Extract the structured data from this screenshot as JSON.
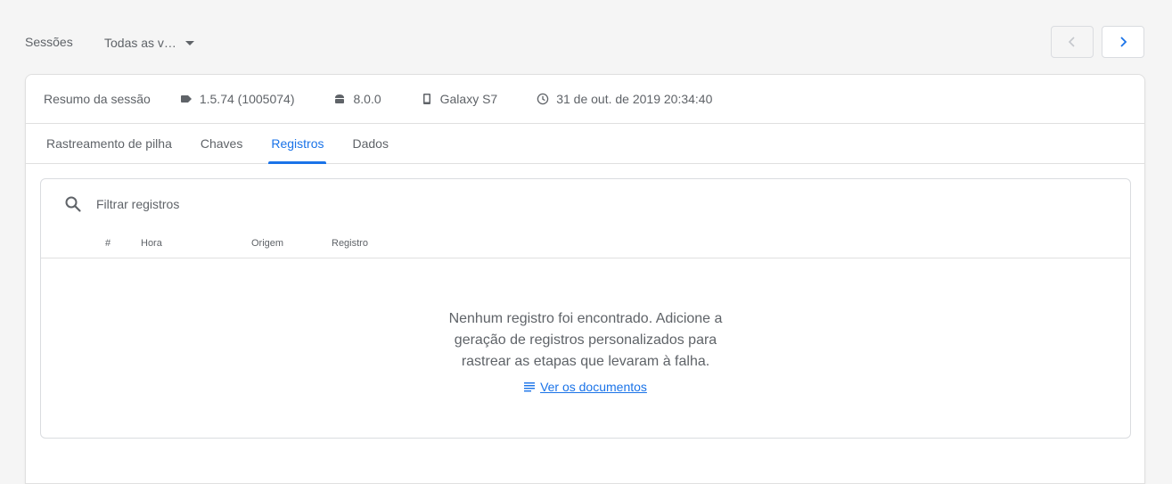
{
  "header": {
    "sessions_label": "Sessões",
    "version_filter": "Todas as v…"
  },
  "summary": {
    "title": "Resumo da sessão",
    "app_version": "1.5.74 (1005074)",
    "os_version": "8.0.0",
    "device": "Galaxy S7",
    "timestamp": "31 de out. de 2019 20:34:40"
  },
  "tabs": [
    {
      "label": "Rastreamento de pilha",
      "active": false
    },
    {
      "label": "Chaves",
      "active": false
    },
    {
      "label": "Registros",
      "active": true
    },
    {
      "label": "Dados",
      "active": false
    }
  ],
  "logs": {
    "filter_placeholder": "Filtrar registros",
    "columns": [
      "#",
      "Hora",
      "Origem",
      "Registro"
    ],
    "empty_message": "Nenhum registro foi encontrado. Adicione a geração de registros personalizados para rastrear as etapas que levaram à falha.",
    "docs_link": "Ver os documentos"
  },
  "colors": {
    "accent": "#1a73e8",
    "text_secondary": "#5f6368",
    "border": "#e0e0e0"
  }
}
